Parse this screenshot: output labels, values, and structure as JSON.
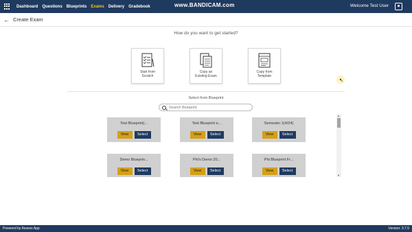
{
  "watermark": "www.BANDICAM.com",
  "nav": {
    "items": [
      "Dashboard",
      "Questions",
      "Blueprints",
      "Exams",
      "Delivery",
      "Gradebook"
    ],
    "active": "Exams",
    "welcome": "Welcome Test User"
  },
  "page": {
    "title": "Create Exam",
    "question": "How do you want to get started?"
  },
  "options": [
    {
      "label_line1": "Start from",
      "label_line2": "Scratch",
      "icon": "checklist-icon"
    },
    {
      "label_line1": "Copy an",
      "label_line2": "Existing Exam",
      "icon": "copy-documents-icon"
    },
    {
      "label_line1": "Copy from",
      "label_line2": "Template",
      "icon": "template-icon"
    }
  ],
  "blueprints": {
    "title": "Select from Blueprint",
    "search_placeholder": "Search Blueprint",
    "view_label": "View",
    "select_label": "Select",
    "items": [
      "Test Blueprint(...",
      "Test Blueprint e...",
      "Semester 1(4/24)",
      "Demo Blueprin...",
      "Phi's Demo 20...",
      "Phi Blueprint Fr..."
    ]
  },
  "footer": {
    "left": "Powered by Assess App",
    "right": "Version: 3.7.5"
  },
  "colors": {
    "navbar": "#1f3a5f",
    "active_nav": "#f5c518",
    "view_button": "#d4a017",
    "select_button": "#1f3a5f",
    "card_bg": "#d0d0d0"
  }
}
